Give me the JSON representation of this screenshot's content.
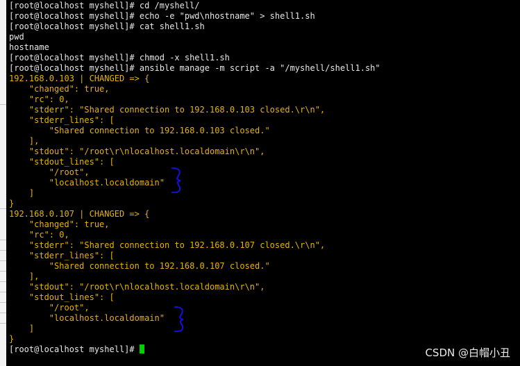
{
  "terminal": {
    "lines": [
      {
        "text": "[root@localhost myshell]# cd /myshell/",
        "color": "white"
      },
      {
        "text": "[root@localhost myshell]# echo -e \"pwd\\nhostname\" > shell1.sh",
        "color": "white"
      },
      {
        "text": "[root@localhost myshell]# cat shell1.sh",
        "color": "white"
      },
      {
        "text": "pwd",
        "color": "white"
      },
      {
        "text": "hostname",
        "color": "white"
      },
      {
        "text": "[root@localhost myshell]# chmod -x shell1.sh",
        "color": "white"
      },
      {
        "text": "[root@localhost myshell]# ansible manage -m script -a \"/myshell/shell1.sh\"",
        "color": "white"
      },
      {
        "text": "192.168.0.103 | CHANGED => {",
        "color": "yellow"
      },
      {
        "text": "    \"changed\": true,",
        "color": "yellow"
      },
      {
        "text": "    \"rc\": 0,",
        "color": "yellow"
      },
      {
        "text": "    \"stderr\": \"Shared connection to 192.168.0.103 closed.\\r\\n\",",
        "color": "yellow"
      },
      {
        "text": "    \"stderr_lines\": [",
        "color": "yellow"
      },
      {
        "text": "        \"Shared connection to 192.168.0.103 closed.\"",
        "color": "yellow"
      },
      {
        "text": "    ],",
        "color": "yellow"
      },
      {
        "text": "    \"stdout\": \"/root\\r\\nlocalhost.localdomain\\r\\n\",",
        "color": "yellow"
      },
      {
        "text": "    \"stdout_lines\": [",
        "color": "yellow"
      },
      {
        "text": "        \"/root\",",
        "color": "yellow"
      },
      {
        "text": "        \"localhost.localdomain\"",
        "color": "yellow"
      },
      {
        "text": "    ]",
        "color": "yellow"
      },
      {
        "text": "}",
        "color": "yellow"
      },
      {
        "text": "192.168.0.107 | CHANGED => {",
        "color": "yellow"
      },
      {
        "text": "    \"changed\": true,",
        "color": "yellow"
      },
      {
        "text": "    \"rc\": 0,",
        "color": "yellow"
      },
      {
        "text": "    \"stderr\": \"Shared connection to 192.168.0.107 closed.\\r\\n\",",
        "color": "yellow"
      },
      {
        "text": "    \"stderr_lines\": [",
        "color": "yellow"
      },
      {
        "text": "        \"Shared connection to 192.168.0.107 closed.\"",
        "color": "yellow"
      },
      {
        "text": "    ],",
        "color": "yellow"
      },
      {
        "text": "    \"stdout\": \"/root\\r\\nlocalhost.localdomain\\r\\n\",",
        "color": "yellow"
      },
      {
        "text": "    \"stdout_lines\": [",
        "color": "yellow"
      },
      {
        "text": "        \"/root\",",
        "color": "yellow"
      },
      {
        "text": "        \"localhost.localdomain\"",
        "color": "yellow"
      },
      {
        "text": "    ]",
        "color": "yellow"
      },
      {
        "text": "}",
        "color": "yellow"
      }
    ],
    "prompt": "[root@localhost myshell]# ",
    "colors": {
      "background": "#000000",
      "white": "#e8e8e8",
      "yellow": "#e6b400",
      "cursor": "#00d000",
      "annotation": "#1010d0"
    }
  },
  "watermark": "CSDN @白帽小丑"
}
